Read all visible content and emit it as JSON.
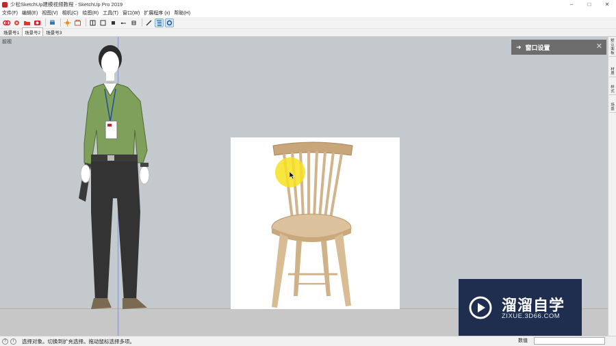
{
  "window": {
    "title": "少松SketchUp建模视频教程 - SketchUp Pro 2019",
    "min_glyph": "–",
    "max_glyph": "□",
    "close_glyph": "✕"
  },
  "menu": [
    "文件(F)",
    "编辑(E)",
    "视图(V)",
    "相机(C)",
    "绘图(R)",
    "工具(T)",
    "窗口(W)",
    "扩展程序 (x)",
    "帮助(H)"
  ],
  "scenes": [
    "场景号1",
    "场景号2",
    "场景号3"
  ],
  "viewport": {
    "label": "前视"
  },
  "tray": {
    "title": "窗口设置",
    "arrow_glyph": "➜",
    "close_glyph": "✕"
  },
  "right_strip": [
    "默认面板",
    "材质",
    "样式",
    "场景"
  ],
  "logo": {
    "name": "溜溜自学",
    "url": "ZIXUE.3D66.COM"
  },
  "status": {
    "text": "选择对象。切换到扩充选择。拖动鼠标选择多项。",
    "measure_label": "数值",
    "measure_value": ""
  },
  "colors": {
    "viewport_bg": "#c3c9cd",
    "highlight": "#f7e021",
    "logo_bg": "#1f2e4e",
    "tray_bg": "#6d6d6d"
  }
}
